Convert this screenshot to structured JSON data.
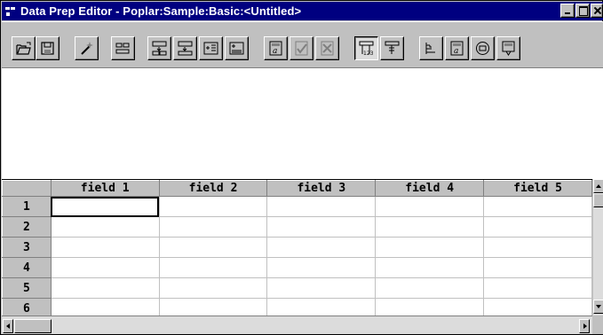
{
  "window": {
    "title": "Data Prep Editor - Poplar:Sample:Basic:<Untitled>",
    "colors": {
      "titlebar": "#000080",
      "face": "#c0c0c0",
      "grid_bg": "#ffffff"
    }
  },
  "toolbar": {
    "buttons": [
      {
        "icon": "open-folder-icon"
      },
      {
        "icon": "save-disk-icon"
      },
      {
        "icon": "magic-wand-icon"
      },
      {
        "icon": "join-fields-icon"
      },
      {
        "icon": "move-fields-icon"
      },
      {
        "icon": "split-field-icon"
      },
      {
        "icon": "create-field-icon"
      },
      {
        "icon": "create-field-text-icon"
      },
      {
        "icon": "field-properties-icon"
      },
      {
        "icon": "select-field-icon"
      },
      {
        "icon": "reject-field-icon"
      },
      {
        "icon": "data-load-settings-icon"
      },
      {
        "icon": "replace-icon"
      },
      {
        "icon": "dimension-build-icon"
      },
      {
        "icon": "associate-outline-icon"
      },
      {
        "icon": "record-view-icon"
      },
      {
        "icon": "display-fields-icon"
      }
    ]
  },
  "grid": {
    "columns": [
      "field 1",
      "field 2",
      "field 3",
      "field 4",
      "field 5"
    ],
    "rows": [
      "1",
      "2",
      "3",
      "4",
      "5",
      "6"
    ]
  }
}
